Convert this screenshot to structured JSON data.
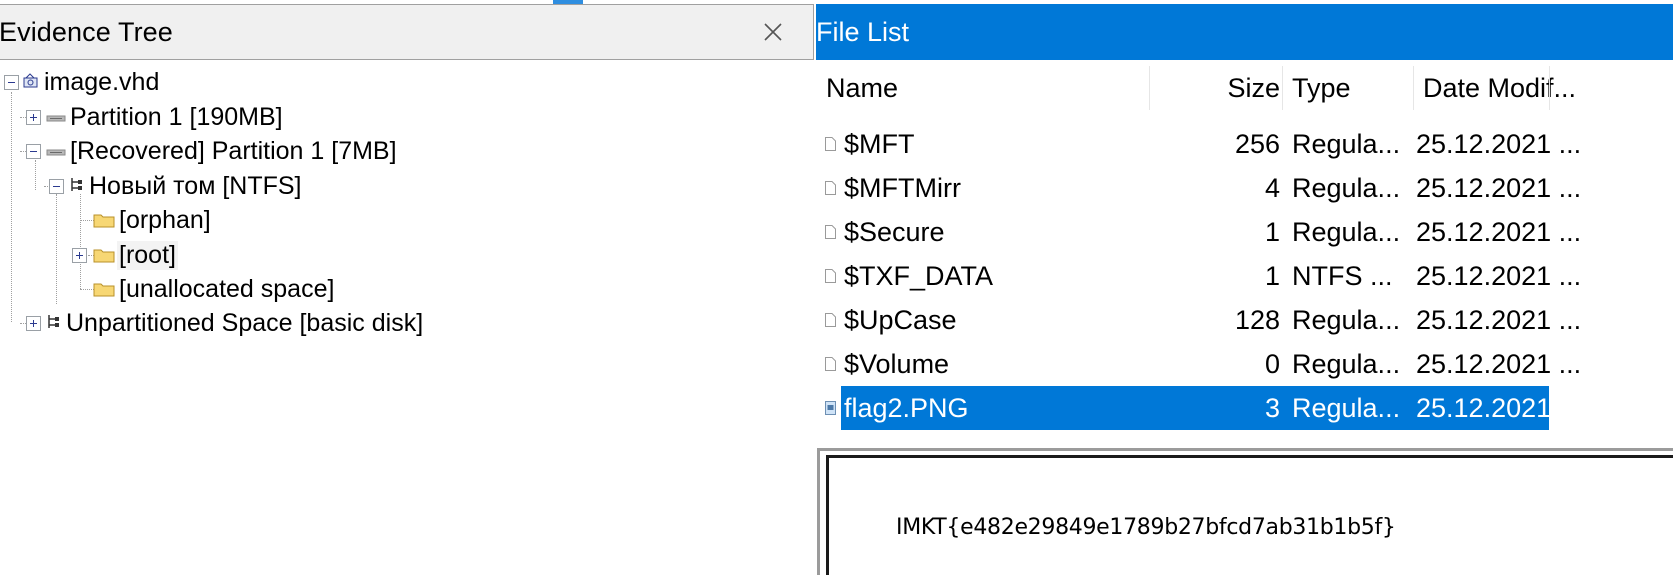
{
  "evidence_tree": {
    "title": "Evidence Tree",
    "close_glyph": "×",
    "nodes": [
      {
        "label": "image.vhd",
        "icon": "disk-image-icon",
        "expander": "minus"
      },
      {
        "label": "Partition 1 [190MB]",
        "icon": "partition-icon",
        "expander": "plus"
      },
      {
        "label": "[Recovered] Partition 1 [7MB]",
        "icon": "partition-icon",
        "expander": "minus"
      },
      {
        "label": "Новый том [NTFS]",
        "icon": "volume-icon",
        "expander": "minus"
      },
      {
        "label": "[orphan]",
        "icon": "folder-icon"
      },
      {
        "label": "[root]",
        "icon": "folder-icon",
        "expander": "plus"
      },
      {
        "label": "[unallocated space]",
        "icon": "folder-icon"
      },
      {
        "label": "Unpartitioned Space [basic disk]",
        "icon": "volume-icon",
        "expander": "plus"
      }
    ]
  },
  "file_list": {
    "title": "File List",
    "columns": [
      "Name",
      "Size",
      "Type",
      "Date Modif..."
    ],
    "rows": [
      {
        "name": "$MFT",
        "size": "256",
        "type": "Regula...",
        "date": "25.12.2021 ..."
      },
      {
        "name": "$MFTMirr",
        "size": "4",
        "type": "Regula...",
        "date": "25.12.2021 ..."
      },
      {
        "name": "$Secure",
        "size": "1",
        "type": "Regula...",
        "date": "25.12.2021 ..."
      },
      {
        "name": "$TXF_DATA",
        "size": "1",
        "type": "NTFS ...",
        "date": "25.12.2021 ..."
      },
      {
        "name": "$UpCase",
        "size": "128",
        "type": "Regula...",
        "date": "25.12.2021 ..."
      },
      {
        "name": "$Volume",
        "size": "0",
        "type": "Regula...",
        "date": "25.12.2021 ..."
      },
      {
        "name": "flag2.PNG",
        "size": "3",
        "type": "Regula...",
        "date": "25.12.2021 ...",
        "selected": true
      }
    ]
  },
  "preview": {
    "text": "IMKT{e482e29849e1789b27bfcd7ab31b1b5f}"
  },
  "colors": {
    "accent": "#0078d7",
    "header_bg": "#f0f0f0"
  }
}
